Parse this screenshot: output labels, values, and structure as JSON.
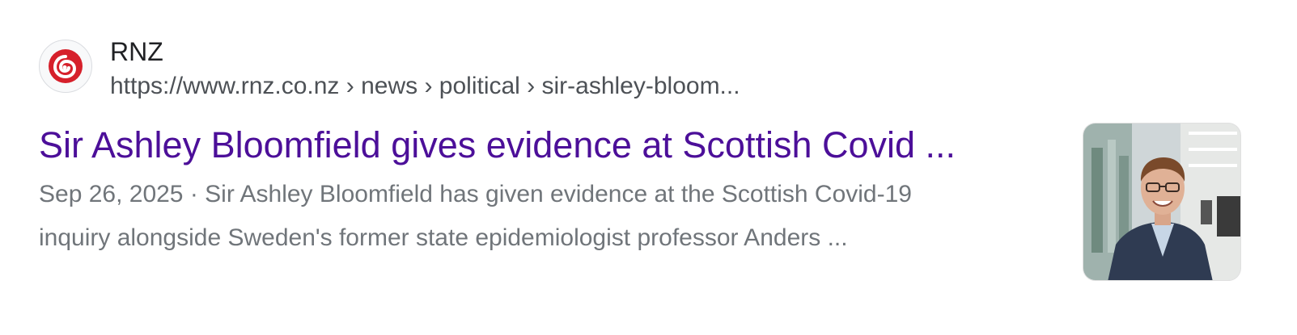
{
  "result": {
    "site_name": "RNZ",
    "url_breadcrumb": "https://www.rnz.co.nz › news › political › sir-ashley-bloom...",
    "title": "Sir Ashley Bloomfield gives evidence at Scottish Covid ...",
    "date": "Sep 26, 2025",
    "separator": " · ",
    "snippet_line1": "Sir Ashley Bloomfield has given evidence at the Scottish Covid-19",
    "snippet_line2": "inquiry alongside Sweden's former state epidemiologist professor Anders ..."
  },
  "icons": {
    "favicon": "rnz-logo-icon",
    "thumbnail": "person-photo-thumbnail"
  },
  "colors": {
    "title_link": "#4c0f99",
    "snippet_text": "#70757a",
    "url_text": "#4d5156",
    "brand_red": "#d6202b"
  }
}
